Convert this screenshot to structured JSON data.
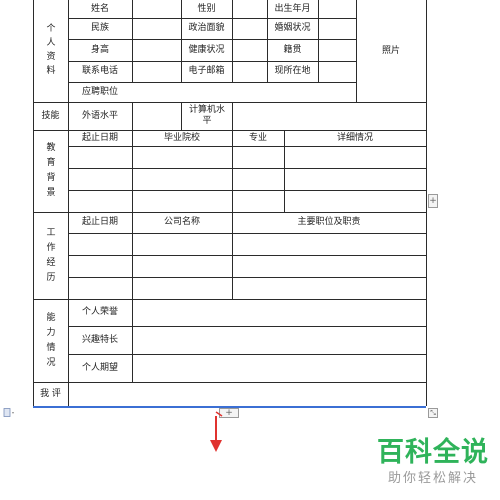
{
  "personal": {
    "section": "个人资料",
    "name": "姓名",
    "gender": "性别",
    "birth": "出生年月",
    "ethnicity": "民族",
    "politics": "政治面貌",
    "marital": "婚姻状况",
    "height": "身高",
    "health": "健康状况",
    "origin": "籍贯",
    "phone": "联系电话",
    "email": "电子邮箱",
    "residence": "现所在地",
    "position": "应聘职位",
    "photo": "照片"
  },
  "skills": {
    "section": "技能",
    "language": "外语水平",
    "computer": "计算机水平"
  },
  "education": {
    "section": "教育背景",
    "headers": [
      "起止日期",
      "毕业院校",
      "专业",
      "详细情况"
    ]
  },
  "work": {
    "section": "工作经历",
    "headers": [
      "起止日期",
      "公司名称",
      "主要职位及职责"
    ]
  },
  "ability": {
    "section": "能力情况",
    "items": [
      "个人荣誉",
      "兴趣特长",
      "个人期望"
    ]
  },
  "evaluation": {
    "section": "我 评"
  },
  "controls": {
    "add": "+",
    "resize": "⤡"
  },
  "watermark": {
    "title": "百科全说",
    "subtitle": "助你轻松解决"
  },
  "colors": {
    "grid": "#2b2b2b",
    "selection": "#3b6fd4",
    "arrow": "#e0322f",
    "watermark": "#2fb35a"
  }
}
